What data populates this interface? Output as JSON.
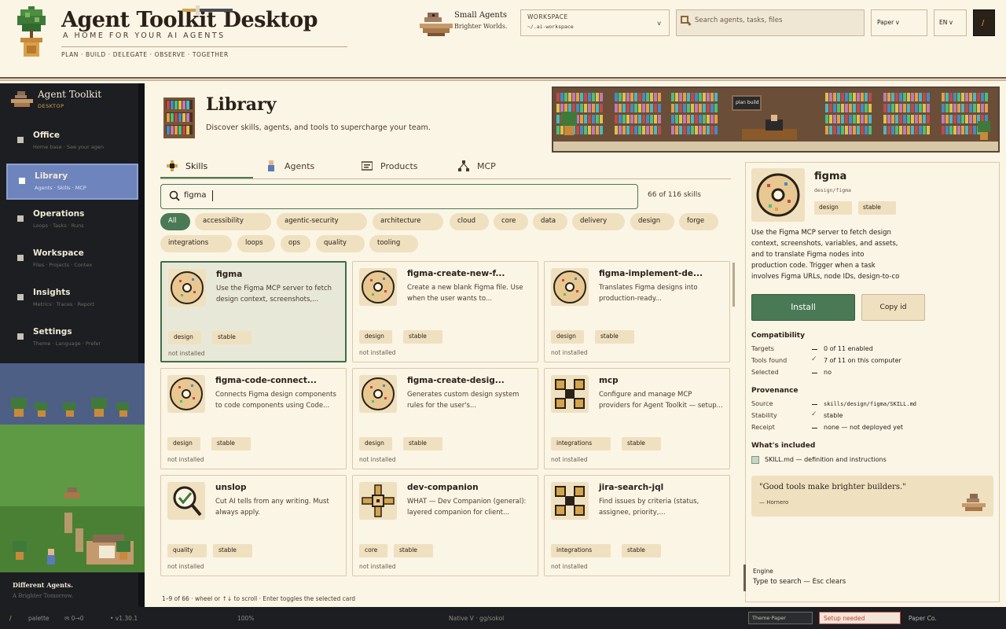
{
  "header": {
    "app_title": "Agent Toolkit Desktop",
    "app_subtitle": "A HOME FOR YOUR AI AGENTS",
    "app_tags": "PLAN · BUILD · DELEGATE · OBSERVE · TOGETHER",
    "brand_line1": "Small Agents",
    "brand_line2": "Brighter Worlds.",
    "workspace_label": "WORKSPACE",
    "workspace_value": "~/.ai-workspace",
    "workspace_caret": "v",
    "search_placeholder": "Search agents, tasks, files",
    "theme_select": "Paper v",
    "lang_select": "EN v",
    "slash_button": "/"
  },
  "sidebar": {
    "title": "Agent Toolkit",
    "subtitle": "DESKTOP",
    "items": [
      {
        "label": "Office",
        "desc": "Home base · See your agen"
      },
      {
        "label": "Library",
        "desc": "Agents · Skills · MCP"
      },
      {
        "label": "Operations",
        "desc": "Loops · Tasks · Runs"
      },
      {
        "label": "Workspace",
        "desc": "Files · Projects · Contex"
      },
      {
        "label": "Insights",
        "desc": "Metrics · Traces · Report"
      },
      {
        "label": "Settings",
        "desc": "Theme · Language · Prefer"
      }
    ],
    "footer_line1": "Different Agents.",
    "footer_line2": "A Brighter Tomorrow."
  },
  "main": {
    "page_title": "Library",
    "page_subtitle": "Discover skills, agents, and tools to supercharge your team.",
    "banner_sign": "plan build",
    "tabs": [
      {
        "label": "Skills"
      },
      {
        "label": "Agents"
      },
      {
        "label": "Products"
      },
      {
        "label": "MCP"
      }
    ],
    "filter_value": "figma",
    "result_count": "66 of 116 skills",
    "chips": [
      "All",
      "accessibility",
      "agentic-security",
      "architecture",
      "cloud",
      "core",
      "data",
      "delivery",
      "design",
      "forge",
      "integrations",
      "loops",
      "ops",
      "quality",
      "tooling"
    ],
    "cards": [
      {
        "name": "figma",
        "desc": "Use the Figma MCP server to fetch design context, screenshots,...",
        "tags": [
          "design",
          "stable"
        ],
        "status": "not installed"
      },
      {
        "name": "figma-create-new-f...",
        "desc": "Create a new blank Figma file. Use when the user wants to...",
        "tags": [
          "design",
          "stable"
        ],
        "status": "not installed"
      },
      {
        "name": "figma-implement-de...",
        "desc": "Translates Figma designs into production-ready...",
        "tags": [
          "design",
          "stable"
        ],
        "status": "not installed"
      },
      {
        "name": "figma-code-connect...",
        "desc": "Connects Figma design components to code components using Code...",
        "tags": [
          "design",
          "stable"
        ],
        "status": "not installed"
      },
      {
        "name": "figma-create-desig...",
        "desc": "Generates custom design system rules for the user's...",
        "tags": [
          "design",
          "stable"
        ],
        "status": "not installed"
      },
      {
        "name": "mcp",
        "desc": "Configure and manage MCP providers for Agent Toolkit — setup...",
        "tags": [
          "integrations",
          "stable"
        ],
        "status": "not installed"
      },
      {
        "name": "unslop",
        "desc": "Cut AI tells from any writing. Must always apply.",
        "tags": [
          "quality",
          "stable"
        ],
        "status": "not installed"
      },
      {
        "name": "dev-companion",
        "desc": "WHAT — Dev Companion (general): layered companion for client...",
        "tags": [
          "core",
          "stable"
        ],
        "status": "not installed"
      },
      {
        "name": "jira-search-jql",
        "desc": "Find issues by criteria (status, assignee, priority,...",
        "tags": [
          "integrations",
          "stable"
        ],
        "status": "not installed"
      }
    ],
    "scroll_hint": "1–9 of 66 · wheel or ↑↓ to scroll · Enter toggles the selected card"
  },
  "detail": {
    "name": "figma",
    "path": "design/figma",
    "tags": [
      "design",
      "stable"
    ],
    "description": "Use the Figma MCP server to fetch design context, screenshots, variables, and assets, and to translate Figma nodes into production code. Trigger when a task involves Figma URLs, node IDs, design-to-co",
    "install_label": "Install",
    "copy_label": "Copy id",
    "compat_heading": "Compatibility",
    "targets_key": "Targets",
    "targets_value": "0 of 11 enabled",
    "tools_key": "Tools found",
    "tools_value": "7 of 11 on this computer",
    "selected_key": "Selected",
    "selected_value": "no",
    "prov_heading": "Provenance",
    "source_key": "Source",
    "source_value": "skills/design/figma/SKILL.md",
    "stability_key": "Stability",
    "stability_value": "stable",
    "receipt_key": "Receipt",
    "receipt_value": "none — not deployed yet",
    "included_heading": "What's included",
    "included_item": "SKILL.md — definition and instructions",
    "quote": "\"Good tools make brighter builders.\"",
    "quote_author": "— Hornero",
    "engine_label": "Engine",
    "engine_hint": "Type to search — Esc clears"
  },
  "statusbar": {
    "slash": "/",
    "palette": "palette",
    "keys": "✉ 0→0",
    "version": "• v1.30.1",
    "zoom": "100%",
    "zoom_level": 0.3,
    "engine": "Native V · gg/sokol",
    "theme_chip": "Theme·Paper",
    "setup_chip": "Setup needed",
    "company": "Paper Co."
  },
  "colors": {
    "accent_green": "#4a7a55",
    "sidebar_active": "#6e84bd",
    "sidebar_bg": "#1c1e22",
    "paper_bg": "#fbf5e6",
    "gold": "#d4a44c",
    "warning_red": "#c04040"
  },
  "icons": {
    "logo": "potted-plant-icon",
    "brand": "bird-nest-icon",
    "search": "search-icon",
    "skills_tab": "sparkle-icon",
    "agents_tab": "person-icon",
    "products_tab": "box-icon",
    "mcp_tab": "network-icon",
    "skill_card": "donut-icon",
    "mcp_card": "connector-icon",
    "unslop_card": "magnifier-check-icon",
    "devcomp_card": "star-compass-icon"
  }
}
